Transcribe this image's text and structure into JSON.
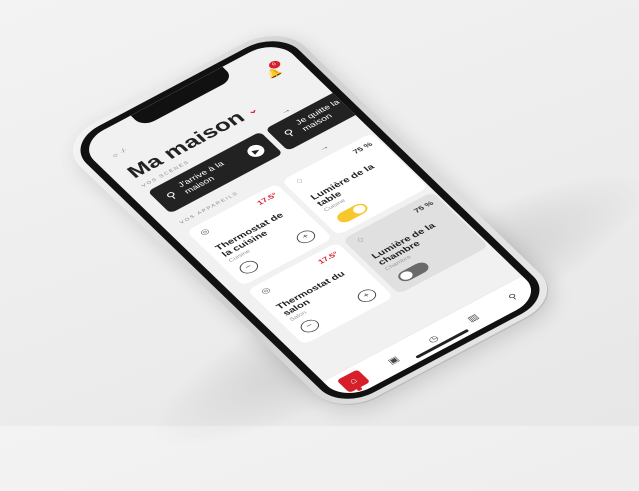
{
  "status_icon": "sun",
  "status_text": "·/·",
  "notification_count": "0",
  "app_title": "Ma maison",
  "sections": {
    "scenes": "VOS SCÈNES",
    "devices": "VOS APPAREILS"
  },
  "scenes": [
    {
      "label": "J'arrive à la maison",
      "icon": "person"
    },
    {
      "label": "Je quitte la maison",
      "icon": "person"
    }
  ],
  "devices": [
    {
      "type": "thermostat",
      "name": "Thermostat de la cuisine",
      "room": "Cuisine",
      "value": "17.5°",
      "minus": "−",
      "plus": "+"
    },
    {
      "type": "light",
      "name": "Lumière de la table",
      "room": "Cuisine",
      "value": "75 %",
      "on": true
    },
    {
      "type": "thermostat",
      "name": "Thermostat du salon",
      "room": "Salon",
      "value": "17.5°",
      "minus": "−",
      "plus": "+"
    },
    {
      "type": "light",
      "name": "Lumière de la chambre",
      "room": "Chambre",
      "value": "75 %",
      "on": false
    }
  ],
  "tabs": [
    {
      "icon": "home"
    },
    {
      "icon": "plan"
    },
    {
      "icon": "clock"
    },
    {
      "icon": "stats"
    },
    {
      "icon": "user"
    }
  ],
  "colors": {
    "accent": "#d71f2b",
    "dark_card": "#222222",
    "toggle_on": "#f7c72b",
    "toggle_off": "#6a6a6a"
  }
}
